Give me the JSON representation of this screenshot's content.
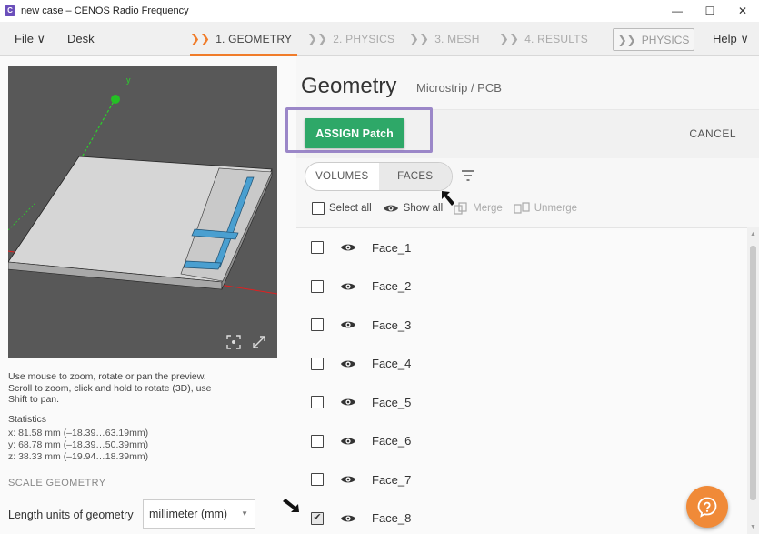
{
  "window": {
    "title": "new case – CENOS Radio Frequency",
    "minimize": "—",
    "maximize": "☐",
    "close": "✕"
  },
  "menu": {
    "file": "File ∨",
    "desk": "Desk",
    "help": "Help ∨",
    "physics_button": "PHYSICS",
    "chevron": "❯❯"
  },
  "steps": [
    {
      "label": "1. GEOMETRY",
      "active": true
    },
    {
      "label": "2. PHYSICS",
      "active": false
    },
    {
      "label": "3. MESH",
      "active": false
    },
    {
      "label": "4. RESULTS",
      "active": false
    }
  ],
  "viewport": {
    "axis_label_y": "y"
  },
  "left": {
    "help_lines": [
      "Use mouse to zoom, rotate or pan the preview.",
      "Scroll to zoom, click and hold to rotate (3D), use",
      "Shift to pan."
    ],
    "stats_title": "Statistics",
    "stats": [
      "x: 81.58 mm  (–18.39…63.19mm)",
      "y: 68.78 mm  (–18.39…50.39mm)",
      "z: 38.33 mm  (–19.94…18.39mm)"
    ],
    "scale_title": "SCALE GEOMETRY",
    "units_label": "Length units of geometry",
    "units_value": "millimeter (mm)"
  },
  "right": {
    "title": "Geometry",
    "subtitle": "Microstrip / PCB",
    "assign_label": "ASSIGN Patch",
    "cancel_label": "CANCEL",
    "toggle": {
      "volumes": "VOLUMES",
      "faces": "FACES",
      "selected": "faces"
    },
    "toolbar": {
      "select_all": "Select all",
      "show_all": "Show all",
      "merge": "Merge",
      "unmerge": "Unmerge"
    },
    "faces": [
      {
        "name": "Face_1",
        "checked": false
      },
      {
        "name": "Face_2",
        "checked": false
      },
      {
        "name": "Face_3",
        "checked": false
      },
      {
        "name": "Face_4",
        "checked": false
      },
      {
        "name": "Face_5",
        "checked": false
      },
      {
        "name": "Face_6",
        "checked": false
      },
      {
        "name": "Face_7",
        "checked": false
      },
      {
        "name": "Face_8",
        "checked": true
      }
    ]
  },
  "colors": {
    "accent": "#f07c2a",
    "assign_green": "#2ea868",
    "highlight_purple": "#9b87c8",
    "help_orange": "#f08a38"
  }
}
